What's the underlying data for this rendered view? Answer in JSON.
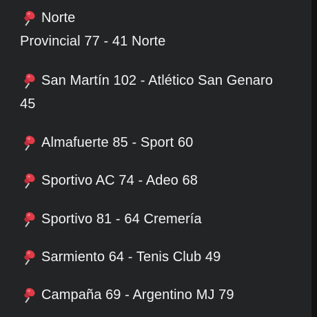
{
  "colors": {
    "background": "#232425",
    "text": "#f2f2f2",
    "pin": "#e03b49"
  },
  "icon": "pushpin-icon",
  "messages": [
    {
      "line1": "Norte",
      "line2": "Provincial 77 - 41 Norte"
    },
    {
      "line1": "San Martín 102 - Atlético San Genaro",
      "line2": "45"
    },
    {
      "line1": "Almafuerte 85 - Sport 60"
    },
    {
      "line1": "Sportivo AC 74 - Adeo 68"
    },
    {
      "line1": "Sportivo 81 - 64 Cremería"
    },
    {
      "line1": "Sarmiento 64 - Tenis Club 49"
    },
    {
      "line1": "Campaña 69 - Argentino MJ 79"
    }
  ]
}
